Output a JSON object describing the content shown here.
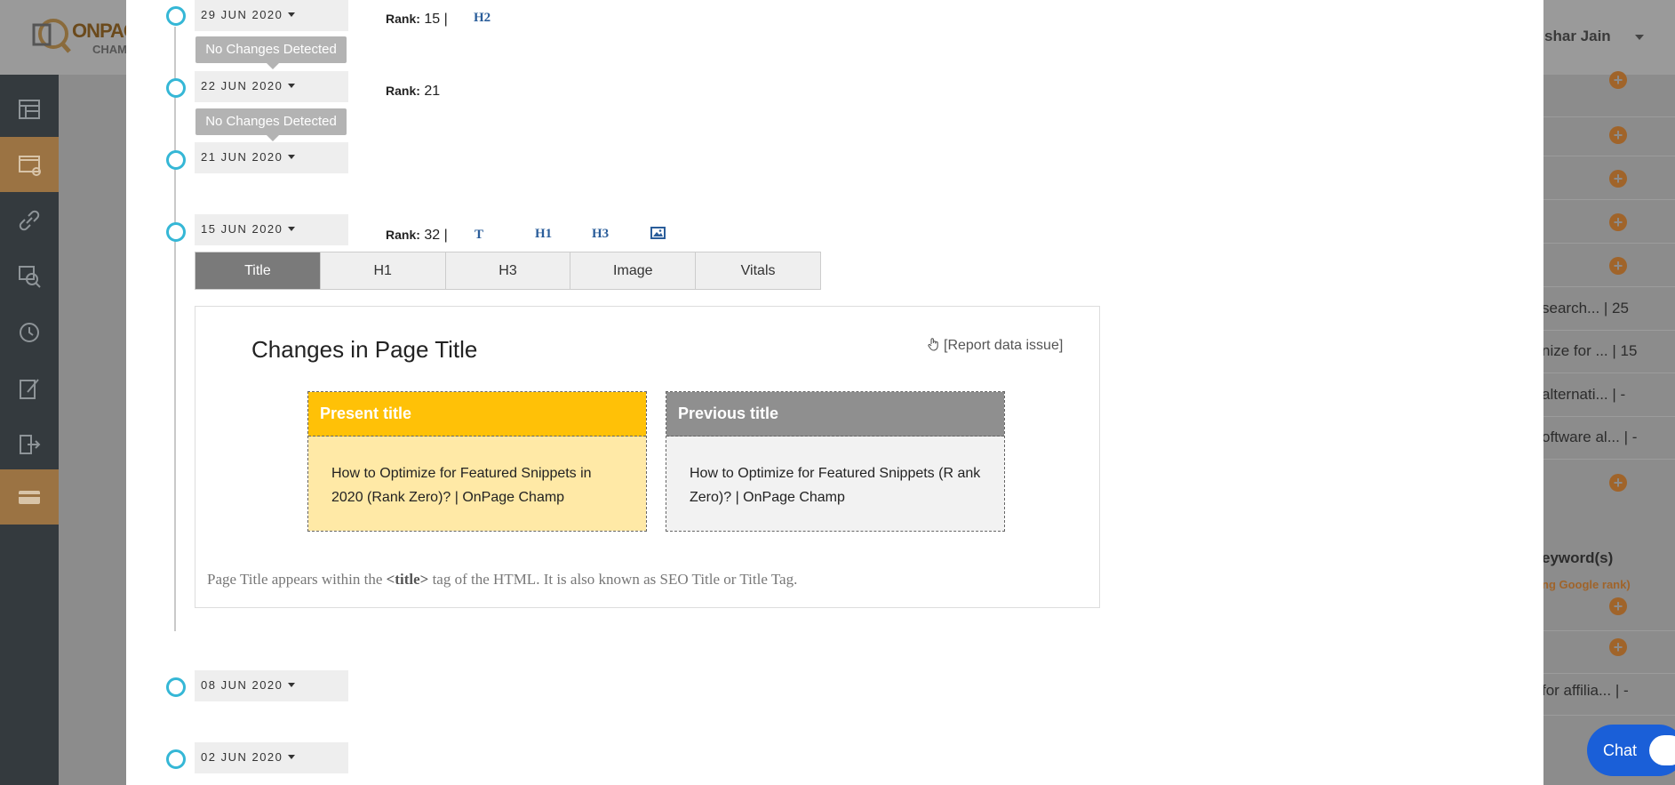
{
  "app": {
    "logo_line1": "ONPAG",
    "logo_line2": "CHAM",
    "user_name": "tushar Jain"
  },
  "sidebar": {
    "items": [
      {
        "icon": "table-icon",
        "active": false
      },
      {
        "icon": "page-check-icon",
        "active": true
      },
      {
        "icon": "link-icon",
        "active": false
      },
      {
        "icon": "image-search-icon",
        "active": false
      },
      {
        "icon": "history-icon",
        "active": false
      },
      {
        "icon": "edit-icon",
        "active": false
      },
      {
        "icon": "exit-icon",
        "active": false
      },
      {
        "icon": "card-icon",
        "active": true
      }
    ]
  },
  "background": {
    "rows": [
      {
        "text": ""
      },
      {
        "text": ""
      },
      {
        "text": ""
      },
      {
        "text": ""
      },
      {
        "text": ""
      },
      {
        "text": "search... |  25"
      },
      {
        "text": "nize for ... |  15"
      },
      {
        "text": "alternati... |  -"
      },
      {
        "text": "oftware al... |  -"
      },
      {
        "text": ""
      }
    ],
    "keywords_heading": "eyword(s)",
    "keywords_sub": "ng Google rank)",
    "rows2": [
      {
        "text": ""
      },
      {
        "text": ""
      },
      {
        "text": "for affilia... |  -"
      }
    ]
  },
  "chat": {
    "label": "Chat"
  },
  "timeline": {
    "entries": [
      {
        "date": "29 JUN 2020",
        "rank_label": "Rank:",
        "rank": "15 |",
        "tags": [
          "H2"
        ],
        "note": "No Changes Detected"
      },
      {
        "date": "22 JUN 2020",
        "rank_label": "Rank:",
        "rank": "21",
        "tags": [],
        "note": "No Changes Detected"
      },
      {
        "date": "21 JUN 2020"
      },
      {
        "date": "15 JUN 2020",
        "rank_label": "Rank:",
        "rank": "32 |",
        "tags": [
          "T",
          "H1",
          "H3"
        ]
      },
      {
        "date": "08 JUN 2020"
      },
      {
        "date": "02 JUN 2020"
      }
    ]
  },
  "tabs": [
    "Title",
    "H1",
    "H3",
    "Image",
    "Vitals"
  ],
  "panel": {
    "title": "Changes in Page Title",
    "report_link": "[Report data issue]",
    "present_label": "Present title",
    "present_text": "How to Optimize for Featured Snippets in 2020 (Rank Zero)? | OnPage Champ",
    "previous_label": "Previous title",
    "previous_text": "How to Optimize for Featured Snippets (R ank Zero)? | OnPage Champ",
    "note_pre": "Page Title appears within the ",
    "note_tag": "<title>",
    "note_post": " tag of the HTML. It is also known as SEO Title or Title Tag."
  }
}
